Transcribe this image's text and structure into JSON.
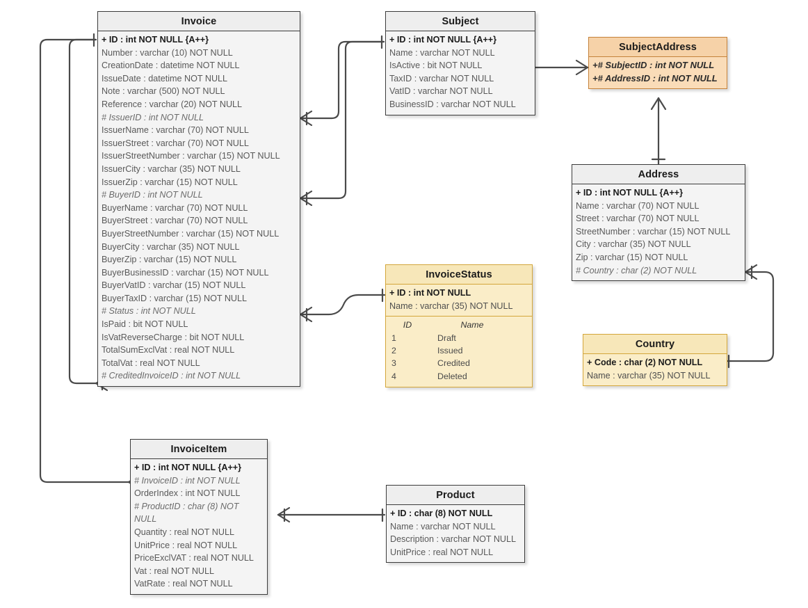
{
  "diagram": {
    "kind": "er-diagram",
    "colors": {
      "line": "#4a4a4a",
      "plain_border": "#3b3b3b",
      "plain_header": "#eeeeee",
      "plain_body": "#f4f4f4",
      "orange_border": "#c4813a",
      "orange_header": "#f6d2a8",
      "orange_body": "#fadcb8",
      "yellow_border": "#d3a63a",
      "yellow_header": "#f7e7b9",
      "yellow_body": "#faedc8"
    }
  },
  "entities": {
    "invoice": {
      "title": "Invoice",
      "attributes": [
        "+ ID : int NOT NULL  {A++}",
        "Number : varchar (10)  NOT NULL",
        "CreationDate : datetime NOT NULL",
        "IssueDate : datetime NOT NULL",
        "Note : varchar (500)  NOT NULL",
        "Reference : varchar (20)  NOT NULL",
        "# IssuerID : int NOT NULL",
        "IssuerName : varchar (70)  NOT NULL",
        "IssuerStreet : varchar (70)  NOT NULL",
        "IssuerStreetNumber : varchar (15)  NOT NULL",
        "IssuerCity : varchar (35)  NOT NULL",
        "IssuerZip : varchar (15)  NOT NULL",
        "# BuyerID : int NOT NULL",
        "BuyerName : varchar (70)  NOT NULL",
        "BuyerStreet : varchar (70)  NOT NULL",
        "BuyerStreetNumber : varchar (15)  NOT NULL",
        "BuyerCity : varchar (35)  NOT NULL",
        "BuyerZip : varchar (15)  NOT NULL",
        "BuyerBusinessID : varchar (15)  NOT NULL",
        "BuyerVatID : varchar (15)  NOT NULL",
        "BuyerTaxID : varchar (15)  NOT NULL",
        "# Status : int NOT NULL",
        "IsPaid : bit NOT NULL",
        "IsVatReverseCharge : bit NOT NULL",
        "TotalSumExclVat : real NOT NULL",
        "TotalVat : real NOT NULL",
        "# CreditedInvoiceID : int NOT NULL"
      ]
    },
    "subject": {
      "title": "Subject",
      "attributes": [
        "+ ID : int NOT NULL  {A++}",
        "Name : varchar NOT NULL",
        "IsActive : bit NOT NULL",
        "TaxID : varchar NOT NULL",
        "VatID : varchar NOT NULL",
        "BusinessID : varchar NOT NULL"
      ]
    },
    "subject_address": {
      "title": "SubjectAddress",
      "attributes": [
        "+# SubjectID : int NOT NULL",
        "+# AddressID : int NOT NULL"
      ]
    },
    "address": {
      "title": "Address",
      "attributes": [
        "+ ID : int NOT NULL  {A++}",
        "Name : varchar (70)  NOT NULL",
        "Street : varchar (70)  NOT NULL",
        "StreetNumber : varchar (15)  NOT NULL",
        "City : varchar (35)  NOT NULL",
        "Zip : varchar (15)  NOT NULL",
        "# Country : char (2)  NOT NULL"
      ]
    },
    "invoice_status": {
      "title": "InvoiceStatus",
      "attributes": [
        "+ ID : int NOT NULL",
        "Name : varchar (35)  NOT NULL"
      ],
      "data": {
        "columns": [
          "ID",
          "Name"
        ],
        "rows": [
          [
            "1",
            "Draft"
          ],
          [
            "2",
            "Issued"
          ],
          [
            "3",
            "Credited"
          ],
          [
            "4",
            "Deleted"
          ]
        ]
      }
    },
    "country": {
      "title": "Country",
      "attributes": [
        "+ Code : char (2)  NOT NULL",
        "Name : varchar (35)  NOT NULL"
      ]
    },
    "invoice_item": {
      "title": "InvoiceItem",
      "attributes": [
        "+ ID : int NOT NULL  {A++}",
        "# InvoiceID : int NOT NULL",
        "OrderIndex : int NOT NULL",
        "# ProductID : char (8)  NOT NULL",
        "Quantity : real NOT NULL",
        "UnitPrice : real NOT NULL",
        "PriceExclVAT : real NOT NULL",
        "Vat : real NOT NULL",
        "VatRate : real NOT NULL"
      ]
    },
    "product": {
      "title": "Product",
      "attributes": [
        "+ ID : char (8)  NOT NULL",
        "Name : varchar NOT NULL",
        "Description : varchar NOT NULL",
        "UnitPrice : real NOT NULL"
      ]
    }
  },
  "relationships": [
    {
      "name": "subject-issuer-invoice",
      "from": "Subject",
      "to": "Invoice",
      "from_card": "one",
      "to_card": "many"
    },
    {
      "name": "subject-buyer-invoice",
      "from": "Subject",
      "to": "Invoice",
      "from_card": "one",
      "to_card": "many"
    },
    {
      "name": "invoicestatus-invoice",
      "from": "InvoiceStatus",
      "to": "Invoice",
      "from_card": "one",
      "to_card": "many"
    },
    {
      "name": "invoice-creditedinvoice",
      "from": "Invoice",
      "to": "Invoice",
      "from_card": "one",
      "to_card": "many"
    },
    {
      "name": "invoice-invoiceitem",
      "from": "Invoice",
      "to": "InvoiceItem",
      "from_card": "one",
      "to_card": "many"
    },
    {
      "name": "product-invoiceitem",
      "from": "Product",
      "to": "InvoiceItem",
      "from_card": "one",
      "to_card": "many"
    },
    {
      "name": "subject-subjectaddress",
      "from": "Subject",
      "to": "SubjectAddress",
      "from_card": "one",
      "to_card": "many"
    },
    {
      "name": "address-subjectaddress",
      "from": "Address",
      "to": "SubjectAddress",
      "from_card": "one",
      "to_card": "many"
    },
    {
      "name": "country-address",
      "from": "Country",
      "to": "Address",
      "from_card": "one",
      "to_card": "many"
    }
  ]
}
